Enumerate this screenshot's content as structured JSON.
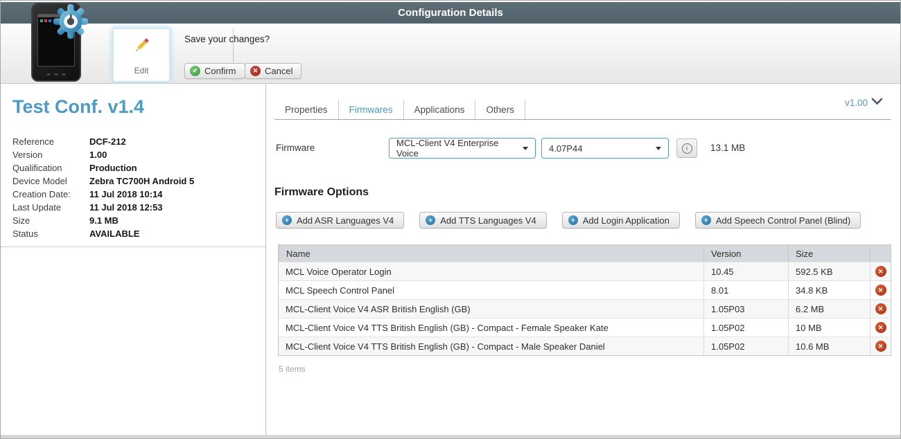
{
  "header": {
    "title": "Configuration Details"
  },
  "toolbar": {
    "edit_label": "Edit",
    "prompt": "Save your changes?",
    "confirm_label": "Confirm",
    "cancel_label": "Cancel"
  },
  "sidebar": {
    "title": "Test Conf. v1.4",
    "properties": [
      {
        "label": "Reference",
        "value": "DCF-212"
      },
      {
        "label": "Version",
        "value": "1.00"
      },
      {
        "label": "Qualification",
        "value": "Production"
      },
      {
        "label": "Device Model",
        "value": "Zebra TC700H Android 5"
      },
      {
        "label": "Creation Date:",
        "value": "11 Jul 2018 10:14"
      },
      {
        "label": "Last Update",
        "value": "11 Jul 2018 12:53"
      },
      {
        "label": "Size",
        "value": "9.1 MB"
      },
      {
        "label": "Status",
        "value": "AVAILABLE"
      }
    ]
  },
  "main": {
    "tabs": [
      {
        "label": "Properties"
      },
      {
        "label": "Firmwares"
      },
      {
        "label": "Applications"
      },
      {
        "label": "Others"
      }
    ],
    "active_tab": "Firmwares",
    "version_selector": "v1.00",
    "firmware": {
      "label": "Firmware",
      "product": "MCL-Client V4 Enterprise Voice",
      "version": "4.07P44",
      "size": "13.1 MB"
    },
    "options": {
      "heading": "Firmware Options",
      "buttons": [
        "Add ASR Languages V4",
        "Add TTS Languages V4",
        "Add Login Application",
        "Add Speech Control Panel (Blind)"
      ]
    },
    "table": {
      "columns": [
        "Name",
        "Version",
        "Size"
      ],
      "rows": [
        {
          "name": "MCL Voice Operator Login",
          "version": "10.45",
          "size": "592.5 KB"
        },
        {
          "name": "MCL Speech Control Panel",
          "version": "8.01",
          "size": "34.8 KB"
        },
        {
          "name": "MCL-Client Voice V4 ASR British English (GB)",
          "version": "1.05P03",
          "size": "6.2 MB"
        },
        {
          "name": "MCL-Client Voice V4 TTS British English (GB) - Compact - Female Speaker Kate",
          "version": "1.05P02",
          "size": "10 MB"
        },
        {
          "name": "MCL-Client Voice V4 TTS British English (GB) - Compact - Male Speaker Daniel",
          "version": "1.05P02",
          "size": "10.6 MB"
        }
      ],
      "footer": "5 items"
    }
  },
  "icons": {
    "confirm_glyph": "✔",
    "cancel_glyph": "✕",
    "add_glyph": "+",
    "info_glyph": "i",
    "delete_glyph": "✕"
  },
  "colors": {
    "accent_blue": "#4a9cc4",
    "titlebar_bg": "#57666f",
    "select_border": "#4f9bbd",
    "confirm_green": "#3d9440",
    "cancel_red": "#9e221a",
    "delete_red": "#aa2f15",
    "table_header_bg": "#d5d9dd"
  }
}
